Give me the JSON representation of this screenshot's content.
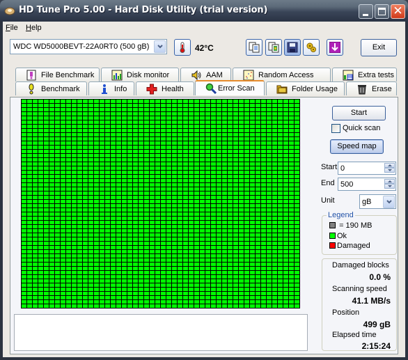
{
  "window": {
    "title": "HD Tune Pro 5.00 - Hard Disk Utility (trial version)",
    "controls": {
      "minimize": "_",
      "maximize": "□",
      "close": "✕"
    }
  },
  "menu": {
    "items": [
      {
        "label": "File",
        "accel": "F",
        "rest": "ile"
      },
      {
        "label": "Help",
        "accel": "H",
        "rest": "elp"
      }
    ]
  },
  "toolbar": {
    "drive": "WDC WD5000BEVT-22A0RT0 (500 gB)",
    "temperature": "42°C",
    "icons": [
      "thermometer-icon",
      "copy-text-icon",
      "copy-screenshot-icon",
      "save-icon",
      "options-icon",
      "download-icon"
    ],
    "exit_label": "Exit"
  },
  "tabs": {
    "row_top": [
      {
        "label": "File Benchmark",
        "icon": "file-benchmark-icon"
      },
      {
        "label": "Disk monitor",
        "icon": "disk-monitor-icon"
      },
      {
        "label": "AAM",
        "icon": "speaker-icon"
      },
      {
        "label": "Random Access",
        "icon": "random-access-icon"
      },
      {
        "label": "Extra tests",
        "icon": "extra-tests-icon"
      }
    ],
    "row_bottom": [
      {
        "label": "Benchmark",
        "icon": "exclamation-icon"
      },
      {
        "label": "Info",
        "icon": "info-icon"
      },
      {
        "label": "Health",
        "icon": "health-cross-icon"
      },
      {
        "label": "Error Scan",
        "icon": "magnifier-icon",
        "selected": true
      },
      {
        "label": "Folder Usage",
        "icon": "folder-icon"
      },
      {
        "label": "Erase",
        "icon": "trash-icon"
      }
    ]
  },
  "scan": {
    "grid_columns": 50,
    "grid_rows": 50,
    "ok_color": "#00ff00",
    "damaged_color": "#ff0000",
    "damaged_cells": [],
    "log_text": ""
  },
  "controls": {
    "start_label": "Start",
    "quick_scan_label": "Quick scan",
    "quick_scan_checked": false,
    "speed_map_label": "Speed map",
    "start_field_label": "Start",
    "start_value": "0",
    "end_field_label": "End",
    "end_value": "500",
    "unit_label": "Unit",
    "unit_value": "gB"
  },
  "legend": {
    "title": "Legend",
    "block_size": "= 190 MB",
    "ok": "Ok",
    "damaged": "Damaged",
    "block_color": "#808080"
  },
  "stats": {
    "damaged_blocks_label": "Damaged blocks",
    "damaged_blocks_value": "0.0 %",
    "scanning_speed_label": "Scanning speed",
    "scanning_speed_value": "41.1 MB/s",
    "position_label": "Position",
    "position_value": "499 gB",
    "elapsed_label": "Elapsed time",
    "elapsed_value": "2:15:24"
  }
}
